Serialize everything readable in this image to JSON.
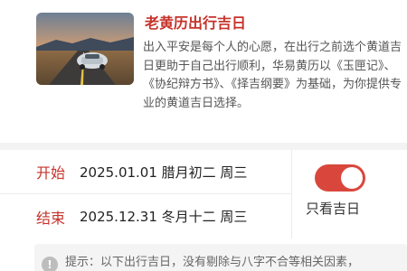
{
  "article": {
    "image": "road-car-sunset-photo",
    "title": "老黄历出行吉日",
    "description": "出入平安是每个人的心愿，在出行之前选个黄道吉日更助于自己出行顺利，华易黄历以《玉匣记》、《协纪辩方书》、《择吉纲要》为基础，为你提供专业的黄道吉日选择。"
  },
  "dates": {
    "start_label": "开始",
    "start_value": "2025.01.01 腊月初二 周三",
    "end_label": "结束",
    "end_value": "2025.12.31 冬月十二 周三"
  },
  "filter": {
    "toggle_on": true,
    "label": "只看吉日",
    "accent": "#d9473c"
  },
  "tip": {
    "icon": "info-icon",
    "text": "提示：以下出行吉日，没有剔除与八字不合等相关因素，"
  }
}
